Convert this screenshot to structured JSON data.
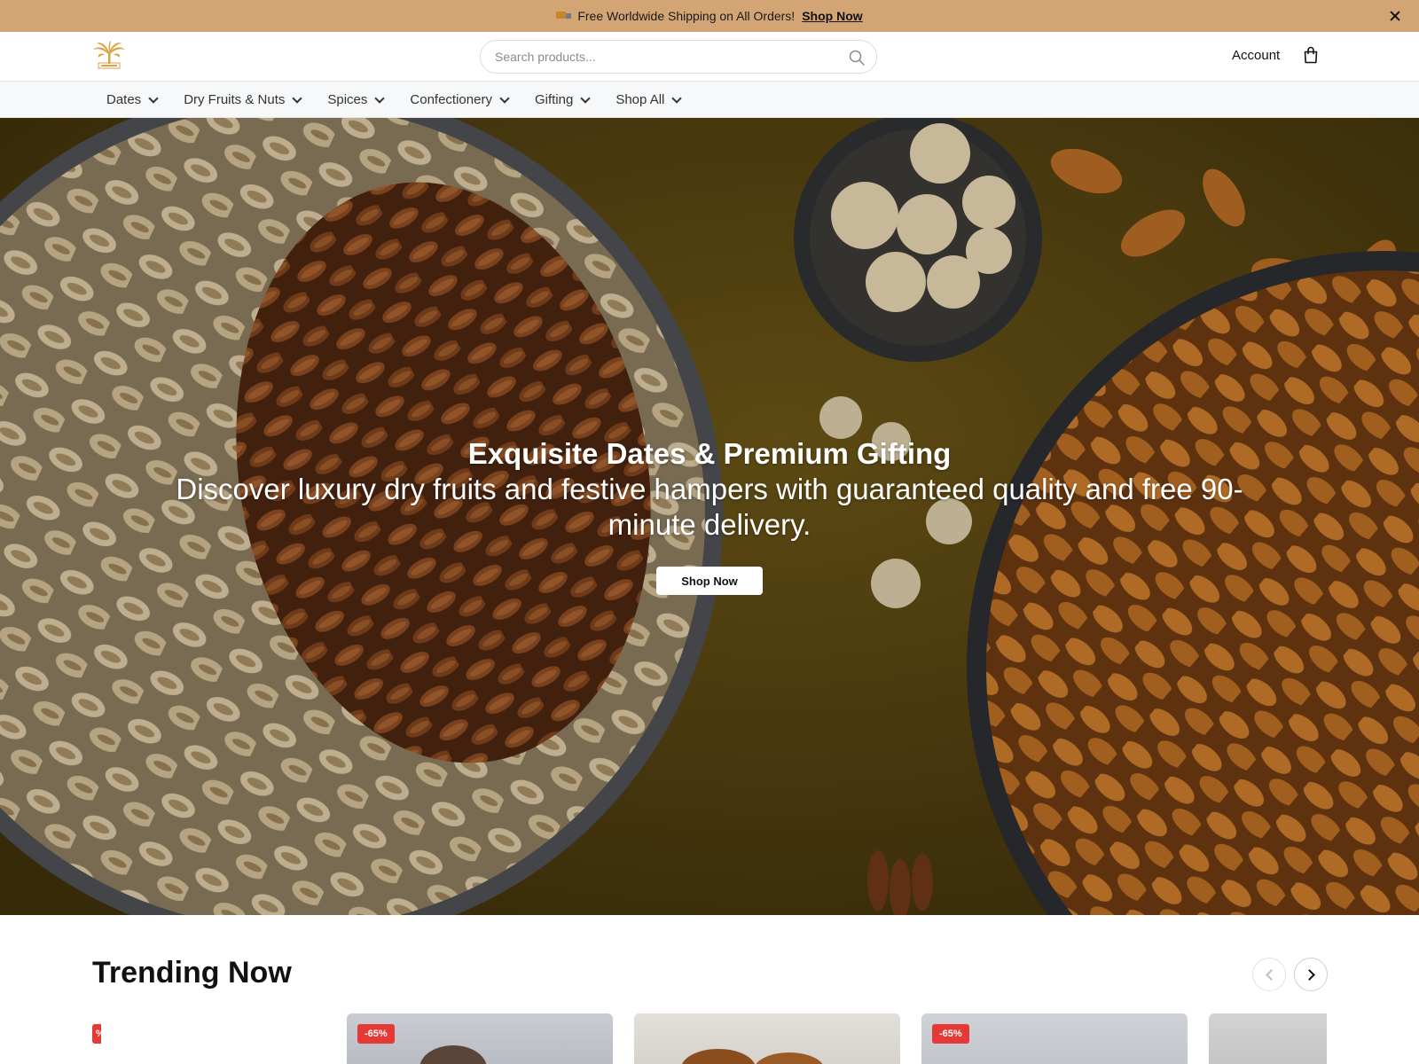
{
  "announcement": {
    "message": "Free Worldwide Shipping on All Orders!",
    "cta": "Shop Now",
    "icon": "truck-icon"
  },
  "header": {
    "logo_icon": "palm-tree-logo",
    "search_placeholder": "Search products...",
    "account_label": "Account",
    "cart_icon": "shopping-bag-icon"
  },
  "nav": {
    "items": [
      {
        "label": "Dates"
      },
      {
        "label": "Dry Fruits & Nuts"
      },
      {
        "label": "Spices"
      },
      {
        "label": "Confectionery"
      },
      {
        "label": "Gifting"
      },
      {
        "label": "Shop All"
      }
    ]
  },
  "hero": {
    "title": "Exquisite Dates & Premium Gifting",
    "subtitle": "Discover luxury dry fruits and festive hampers with guaranteed quality and free 90-minute delivery.",
    "cta": "Shop Now"
  },
  "trending": {
    "heading": "Trending Now",
    "cards": [
      {
        "badge": "%"
      },
      {
        "badge": "-65%"
      },
      {
        "badge": ""
      },
      {
        "badge": "-65%"
      },
      {
        "badge": ""
      }
    ]
  },
  "colors": {
    "announcement_bg": "#d4a574",
    "badge_bg": "#e53935",
    "nav_bg": "#f7f8f9"
  }
}
